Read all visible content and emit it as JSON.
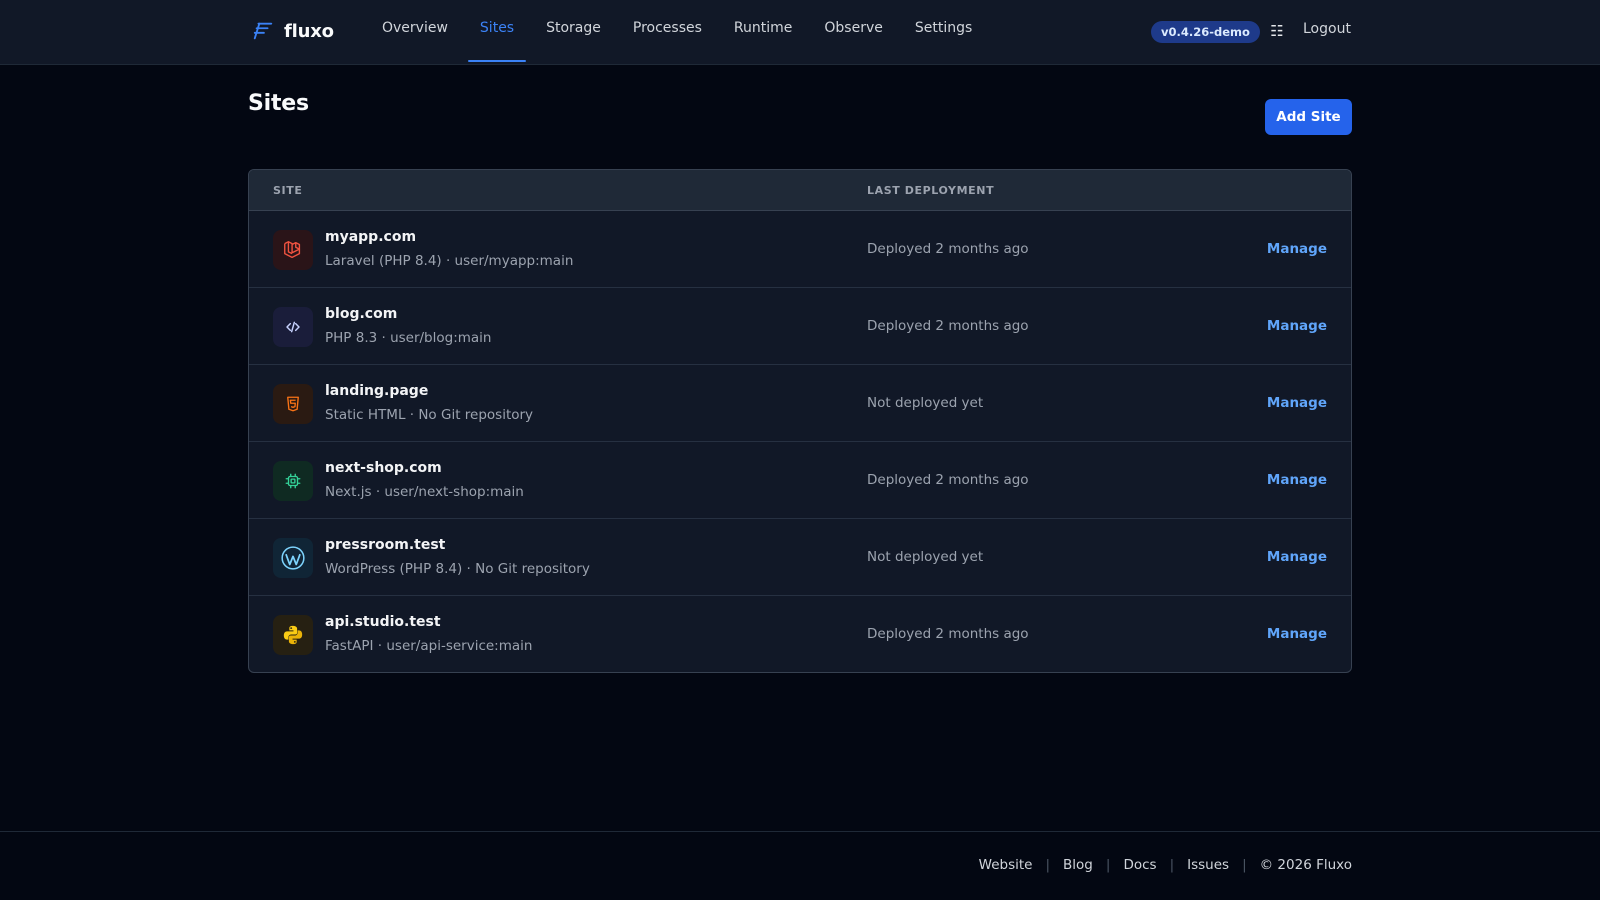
{
  "brand": {
    "name": "fluxo",
    "logo_icon": "fluxo-logo-icon"
  },
  "nav": {
    "items": [
      {
        "label": "Overview"
      },
      {
        "label": "Sites"
      },
      {
        "label": "Storage"
      },
      {
        "label": "Processes"
      },
      {
        "label": "Runtime"
      },
      {
        "label": "Observe"
      },
      {
        "label": "Settings"
      }
    ],
    "active": "Sites"
  },
  "header": {
    "version": "v0.4.26-demo",
    "menu_icon": "grid-menu-icon",
    "logout_label": "Logout"
  },
  "page": {
    "title": "Sites",
    "add_site_label": "Add Site"
  },
  "table": {
    "columns": [
      "Site",
      "Last Deployment"
    ],
    "rows": [
      {
        "name": "myapp.com",
        "meta": "Laravel (PHP 8.4) · user/myapp:main",
        "status": "Deployed 2 months ago",
        "action": "Manage",
        "icon": "laravel-icon"
      },
      {
        "name": "blog.com",
        "meta": "PHP 8.3 · user/blog:main",
        "status": "Deployed 2 months ago",
        "action": "Manage",
        "icon": "code-icon"
      },
      {
        "name": "landing.page",
        "meta": "Static HTML · No Git repository",
        "status": "Not deployed yet",
        "action": "Manage",
        "icon": "html5-icon"
      },
      {
        "name": "next-shop.com",
        "meta": "Next.js · user/next-shop:main",
        "status": "Deployed 2 months ago",
        "action": "Manage",
        "icon": "chip-icon"
      },
      {
        "name": "pressroom.test",
        "meta": "WordPress (PHP 8.4) · No Git repository",
        "status": "Not deployed yet",
        "action": "Manage",
        "icon": "wordpress-icon"
      },
      {
        "name": "api.studio.test",
        "meta": "FastAPI · user/api-service:main",
        "status": "Deployed 2 months ago",
        "action": "Manage",
        "icon": "python-icon"
      }
    ]
  },
  "footer": {
    "links": [
      "Website",
      "Blog",
      "Docs",
      "Issues"
    ],
    "copyright": "© 2026 Fluxo"
  },
  "colors": {
    "accent": "#3b82f6",
    "button": "#2563eb",
    "link": "#60a5fa",
    "background": "#030712",
    "surface": "#111827"
  }
}
